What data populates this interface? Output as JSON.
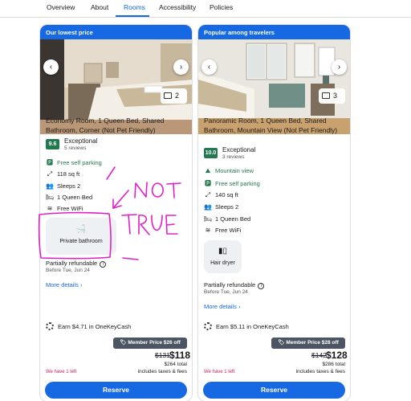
{
  "tabs": [
    {
      "label": "Overview",
      "active": false
    },
    {
      "label": "About",
      "active": false
    },
    {
      "label": "Rooms",
      "active": true
    },
    {
      "label": "Accessibility",
      "active": false
    },
    {
      "label": "Policies",
      "active": false
    }
  ],
  "colors": {
    "accent": "#1668e3",
    "score": "#227950",
    "scarcity": "#c81e5a",
    "member_badge": "#4c5563",
    "annotation": "#e020c8"
  },
  "rooms": [
    {
      "banner": "Our lowest price",
      "photo_count": "2",
      "title": "Economy Room, 1 Queen Bed, Shared Bathroom, Corner (Not Pet Friendly)",
      "score": "9.6",
      "score_label": "Exceptional",
      "reviews": "5 reviews",
      "amenities": [
        {
          "icon": "parking-icon",
          "label": "Free self parking"
        },
        {
          "icon": "area-icon",
          "label": "118 sq ft"
        },
        {
          "icon": "people-icon",
          "label": "Sleeps 2"
        },
        {
          "icon": "bed-icon",
          "label": "1 Queen Bed"
        },
        {
          "icon": "wifi-icon",
          "label": "Free WiFi"
        }
      ],
      "tile": {
        "icon": "bathtub-icon",
        "label": "Private bathroom"
      },
      "refund": "Partially refundable",
      "refund_date": "Before Tue, Jun 24",
      "more": "More details",
      "earn": "Earn $4.71 in OneKeyCash",
      "member": "Member Price $26 off",
      "old_price": "$131",
      "price": "$118",
      "total_1": "$264 total",
      "total_2": "includes taxes & fees",
      "left": "We have 1 left",
      "reserve": "Reserve"
    },
    {
      "banner": "Popular among travelers",
      "photo_count": "3",
      "title": "Panoramic Room, 1 Queen Bed, Shared Bathroom, Mountain View (Not Pet Friendly)",
      "score": "10.0",
      "score_label": "Exceptional",
      "reviews": "3 reviews",
      "amenities": [
        {
          "icon": "mountain-icon",
          "label": "Mountain view"
        },
        {
          "icon": "parking-icon",
          "label": "Free self parking"
        },
        {
          "icon": "area-icon",
          "label": "140 sq ft"
        },
        {
          "icon": "people-icon",
          "label": "Sleeps 2"
        },
        {
          "icon": "bed-icon",
          "label": "1 Queen Bed"
        },
        {
          "icon": "wifi-icon",
          "label": "Free WiFi"
        }
      ],
      "tile": {
        "icon": "hair-dryer-icon",
        "label": "Hair dryer"
      },
      "refund": "Partially refundable",
      "refund_date": "Before Tue, Jun 24",
      "more": "More details",
      "earn": "Earn $5.11 in OneKeyCash",
      "member": "Member Price $28 off",
      "old_price": "$142",
      "price": "$128",
      "total_1": "$286 total",
      "total_2": "includes taxes & fees",
      "left": "We have 1 left",
      "reserve": "Reserve"
    }
  ],
  "annotation": {
    "line1": "NOT",
    "line2": "TRUE"
  }
}
